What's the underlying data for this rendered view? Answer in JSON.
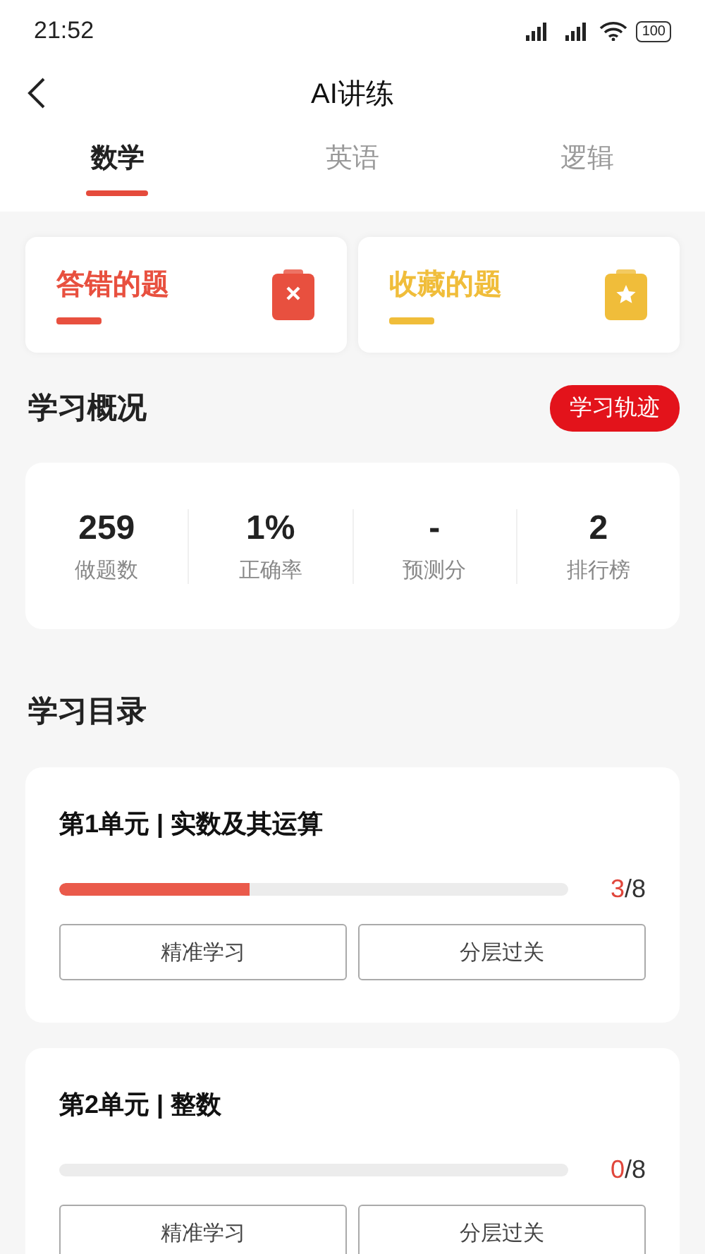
{
  "status_bar": {
    "time": "21:52",
    "battery": "100"
  },
  "header": {
    "title": "AI讲练"
  },
  "tabs": [
    {
      "label": "数学",
      "selected": true
    },
    {
      "label": "英语",
      "selected": false
    },
    {
      "label": "逻辑",
      "selected": false
    }
  ],
  "shortcuts": [
    {
      "label": "答错的题",
      "kind": "wrong",
      "color": "#e8503f"
    },
    {
      "label": "收藏的题",
      "kind": "favorite",
      "color": "#f0bd3a"
    }
  ],
  "overview": {
    "title": "学习概况",
    "button": "学习轨迹",
    "stats": [
      {
        "value": "259",
        "label": "做题数"
      },
      {
        "value": "1%",
        "label": "正确率"
      },
      {
        "value": "-",
        "label": "预测分"
      },
      {
        "value": "2",
        "label": "排行榜"
      }
    ]
  },
  "catalog": {
    "title": "学习目录",
    "units": [
      {
        "title": "第1单元 | 实数及其运算",
        "level": 0.375,
        "done": "3",
        "total": "/8",
        "buttons": [
          "精准学习",
          "分层过关"
        ]
      },
      {
        "title": "第2单元 | 整数",
        "level": 0,
        "done": "0",
        "total": "/8",
        "buttons": [
          "精准学习",
          "分层过关"
        ]
      }
    ]
  }
}
